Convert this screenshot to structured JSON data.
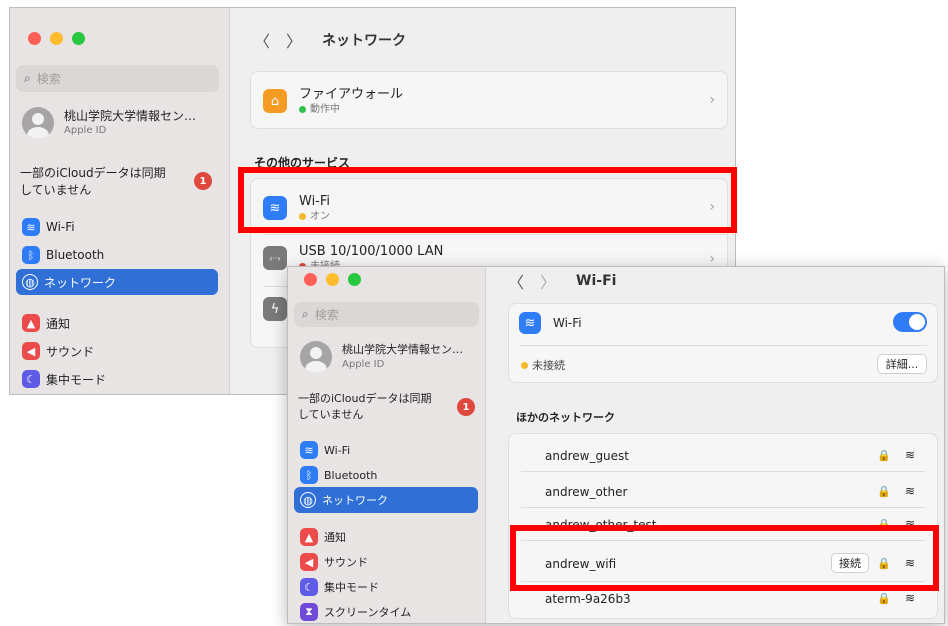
{
  "window1": {
    "nav_title": "ネットワーク",
    "back_glyph": "〈",
    "forward_glyph": "〉",
    "search_placeholder": "検索",
    "profile": {
      "name": "桃山学院大学情報セン…",
      "sub": "Apple ID"
    },
    "icloud_notice": [
      "一部のiCloudデータは同期",
      "していません"
    ],
    "icloud_badge": "1",
    "sidebar": [
      {
        "label": "Wi-Fi",
        "icon": "wifi-icon",
        "glyph": "≋",
        "color": "#2e7cf6"
      },
      {
        "label": "Bluetooth",
        "icon": "bluetooth-icon",
        "glyph": "ᛒ",
        "color": "#2e7cf6"
      },
      {
        "label": "ネットワーク",
        "icon": "globe-icon",
        "glyph": "◍",
        "color": "#2f6fd6",
        "selected": true
      },
      {
        "label": "通知",
        "icon": "bell-icon",
        "glyph": "▲",
        "color": "#ec4b4b"
      },
      {
        "label": "サウンド",
        "icon": "speaker-icon",
        "glyph": "◀",
        "color": "#ec4b4b"
      },
      {
        "label": "集中モード",
        "icon": "moon-icon",
        "glyph": "☾",
        "color": "#5e5ce6"
      }
    ],
    "firewall": {
      "title": "ファイアウォール",
      "status": "動作中",
      "status_color": "#30c24b",
      "icon": "firewall-icon",
      "glyph": "⌂",
      "icon_color": "#f59a23"
    },
    "section_other": "その他のサービス",
    "wifi_service": {
      "title": "Wi-Fi",
      "status": "オン",
      "status_color": "#f2b92d",
      "icon": "wifi-icon",
      "glyph": "≋",
      "icon_color": "#2e7cf6"
    },
    "usb_service": {
      "title": "USB 10/100/1000 LAN",
      "status": "未接続",
      "status_color": "#e0483e",
      "icon": "ethernet-icon",
      "glyph": "‹··›",
      "icon_color": "#7a7a7a"
    },
    "thunderbolt_icon": {
      "icon": "thunderbolt-icon",
      "glyph": "ϟ",
      "icon_color": "#7a7a7a"
    },
    "chevron": "›"
  },
  "window2": {
    "nav_title": "Wi-Fi",
    "back_glyph": "〈",
    "forward_glyph": "〉",
    "search_placeholder": "検索",
    "profile": {
      "name": "桃山学院大学情報セン…",
      "sub": "Apple ID"
    },
    "icloud_notice": [
      "一部のiCloudデータは同期",
      "していません"
    ],
    "icloud_badge": "1",
    "sidebar": [
      {
        "label": "Wi-Fi",
        "icon": "wifi-icon",
        "glyph": "≋",
        "color": "#2e7cf6"
      },
      {
        "label": "Bluetooth",
        "icon": "bluetooth-icon",
        "glyph": "ᛒ",
        "color": "#2e7cf6"
      },
      {
        "label": "ネットワーク",
        "icon": "globe-icon",
        "glyph": "◍",
        "color": "#2f6fd6",
        "selected": true
      },
      {
        "label": "通知",
        "icon": "bell-icon",
        "glyph": "▲",
        "color": "#ec4b4b"
      },
      {
        "label": "サウンド",
        "icon": "speaker-icon",
        "glyph": "◀",
        "color": "#ec4b4b"
      },
      {
        "label": "集中モード",
        "icon": "moon-icon",
        "glyph": "☾",
        "color": "#5e5ce6"
      },
      {
        "label": "スクリーンタイム",
        "icon": "hourglass-icon",
        "glyph": "⧗",
        "color": "#6f4ad6"
      }
    ],
    "wifi_label": "Wi-Fi",
    "wifi_toggle_on": true,
    "status": "未接続",
    "status_color": "#f2b92d",
    "details_button": "詳細...",
    "section_other": "ほかのネットワーク",
    "networks": [
      {
        "name": "andrew_guest",
        "locked": true
      },
      {
        "name": "andrew_other",
        "locked": true
      },
      {
        "name": "andrew_other_test",
        "locked": true
      },
      {
        "name": "andrew_wifi",
        "locked": true,
        "connect_button": "接続"
      },
      {
        "name": "aterm-9a26b3",
        "locked": true
      }
    ],
    "lock_glyph": "🔒",
    "wifi_glyph": "≋"
  },
  "highlight_color": "#ff0000"
}
